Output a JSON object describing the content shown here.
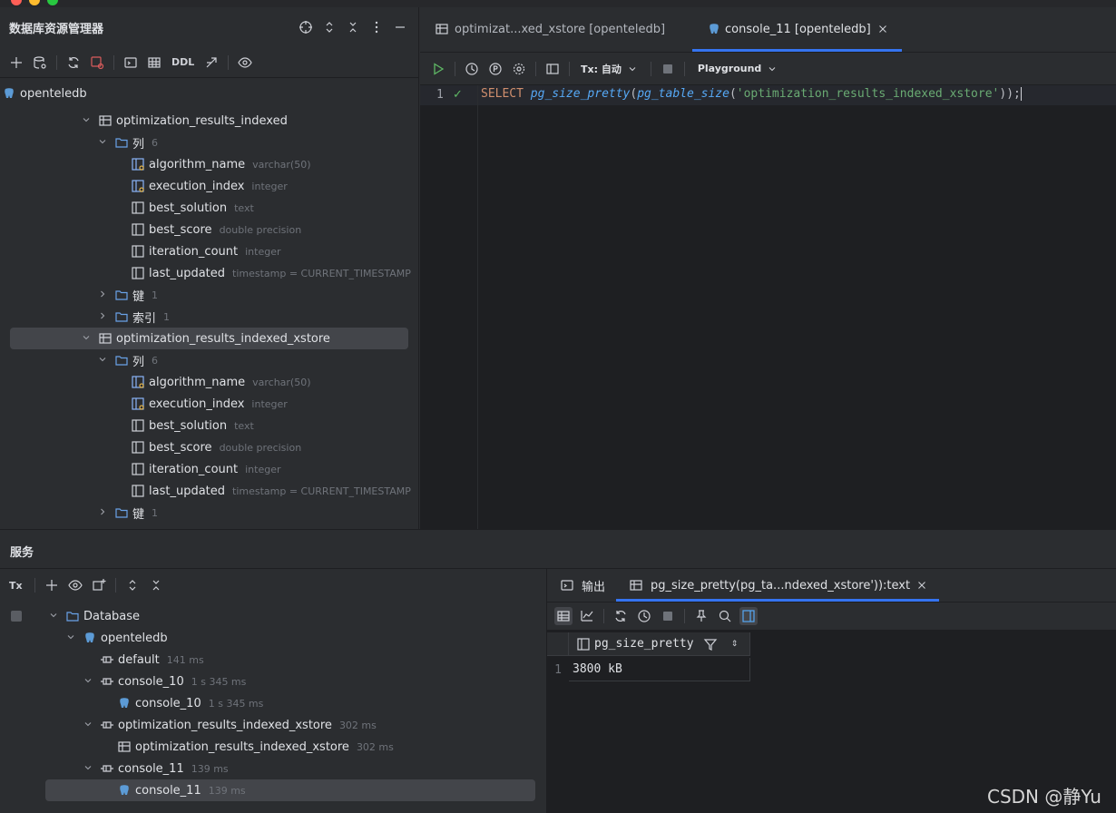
{
  "explorer": {
    "title": "数据库资源管理器",
    "ddl_label": "DDL",
    "datasource": "openteledb",
    "tree": [
      {
        "label": "optimization_results_indexed",
        "meta": "",
        "kind": "table",
        "depth": 0,
        "chev": "down"
      },
      {
        "label": "列",
        "meta": "6",
        "kind": "folder",
        "depth": 1,
        "chev": "down"
      },
      {
        "label": "algorithm_name",
        "meta": "varchar(50)",
        "kind": "keycol",
        "depth": 2,
        "chev": ""
      },
      {
        "label": "execution_index",
        "meta": "integer",
        "kind": "keycol",
        "depth": 2,
        "chev": ""
      },
      {
        "label": "best_solution",
        "meta": "text",
        "kind": "col",
        "depth": 2,
        "chev": ""
      },
      {
        "label": "best_score",
        "meta": "double precision",
        "kind": "col",
        "depth": 2,
        "chev": ""
      },
      {
        "label": "iteration_count",
        "meta": "integer",
        "kind": "col",
        "depth": 2,
        "chev": ""
      },
      {
        "label": "last_updated",
        "meta": "timestamp = CURRENT_TIMESTAMP",
        "kind": "col",
        "depth": 2,
        "chev": ""
      },
      {
        "label": "键",
        "meta": "1",
        "kind": "folder",
        "depth": 1,
        "chev": "right"
      },
      {
        "label": "索引",
        "meta": "1",
        "kind": "folder",
        "depth": 1,
        "chev": "right"
      },
      {
        "label": "optimization_results_indexed_xstore",
        "meta": "",
        "kind": "table",
        "depth": 0,
        "chev": "down",
        "selected": true
      },
      {
        "label": "列",
        "meta": "6",
        "kind": "folder",
        "depth": 1,
        "chev": "down"
      },
      {
        "label": "algorithm_name",
        "meta": "varchar(50)",
        "kind": "keycol",
        "depth": 2,
        "chev": ""
      },
      {
        "label": "execution_index",
        "meta": "integer",
        "kind": "keycol",
        "depth": 2,
        "chev": ""
      },
      {
        "label": "best_solution",
        "meta": "text",
        "kind": "col",
        "depth": 2,
        "chev": ""
      },
      {
        "label": "best_score",
        "meta": "double precision",
        "kind": "col",
        "depth": 2,
        "chev": ""
      },
      {
        "label": "iteration_count",
        "meta": "integer",
        "kind": "col",
        "depth": 2,
        "chev": ""
      },
      {
        "label": "last_updated",
        "meta": "timestamp = CURRENT_TIMESTAMP",
        "kind": "col",
        "depth": 2,
        "chev": ""
      },
      {
        "label": "键",
        "meta": "1",
        "kind": "folder",
        "depth": 1,
        "chev": "right"
      }
    ]
  },
  "editor": {
    "tabs": [
      {
        "label": "optimizat...xed_xstore [openteledb]",
        "active": false
      },
      {
        "label": "console_11 [openteledb]",
        "active": true
      }
    ],
    "tx_label": "Tx: 自动",
    "playground_label": "Playground",
    "line_number": "1",
    "code": {
      "kw": "SELECT",
      "fn1": "pg_size_pretty",
      "p1": "(",
      "fn2": "pg_table_size",
      "p2": "(",
      "str": "'optimization_results_indexed_xstore'",
      "p3": "));"
    }
  },
  "services": {
    "title": "服务",
    "tx_icon_label": "Tx",
    "tree": [
      {
        "label": "Database",
        "meta": "",
        "kind": "folder",
        "depth": 0,
        "chev": "down"
      },
      {
        "label": "openteledb",
        "meta": "",
        "kind": "pg",
        "depth": 1,
        "chev": "down"
      },
      {
        "label": "default",
        "meta": "141 ms",
        "kind": "session",
        "depth": 2,
        "chev": ""
      },
      {
        "label": "console_10",
        "meta": "1 s 345 ms",
        "kind": "session",
        "depth": 2,
        "chev": "down"
      },
      {
        "label": "console_10",
        "meta": "1 s 345 ms",
        "kind": "pg",
        "depth": 3,
        "chev": ""
      },
      {
        "label": "optimization_results_indexed_xstore",
        "meta": "302 ms",
        "kind": "session",
        "depth": 2,
        "chev": "down"
      },
      {
        "label": "optimization_results_indexed_xstore",
        "meta": "302 ms",
        "kind": "table",
        "depth": 3,
        "chev": ""
      },
      {
        "label": "console_11",
        "meta": "139 ms",
        "kind": "session",
        "depth": 2,
        "chev": "down"
      },
      {
        "label": "console_11",
        "meta": "139 ms",
        "kind": "pg",
        "depth": 3,
        "chev": "",
        "selected": true
      }
    ],
    "result_tabs": [
      {
        "label": "输出",
        "active": false
      },
      {
        "label": "pg_size_pretty(pg_ta...ndexed_xstore')):text",
        "active": true
      }
    ],
    "grid": {
      "columns": [
        "pg_size_pretty"
      ],
      "rows": [
        {
          "num": "1",
          "cells": [
            "3800 kB"
          ]
        }
      ]
    }
  },
  "watermark": "CSDN @静Yu",
  "colors": {
    "accent": "#3574f0",
    "keyword": "#cf8e6d",
    "function": "#56a8f5",
    "string": "#6aab73"
  }
}
